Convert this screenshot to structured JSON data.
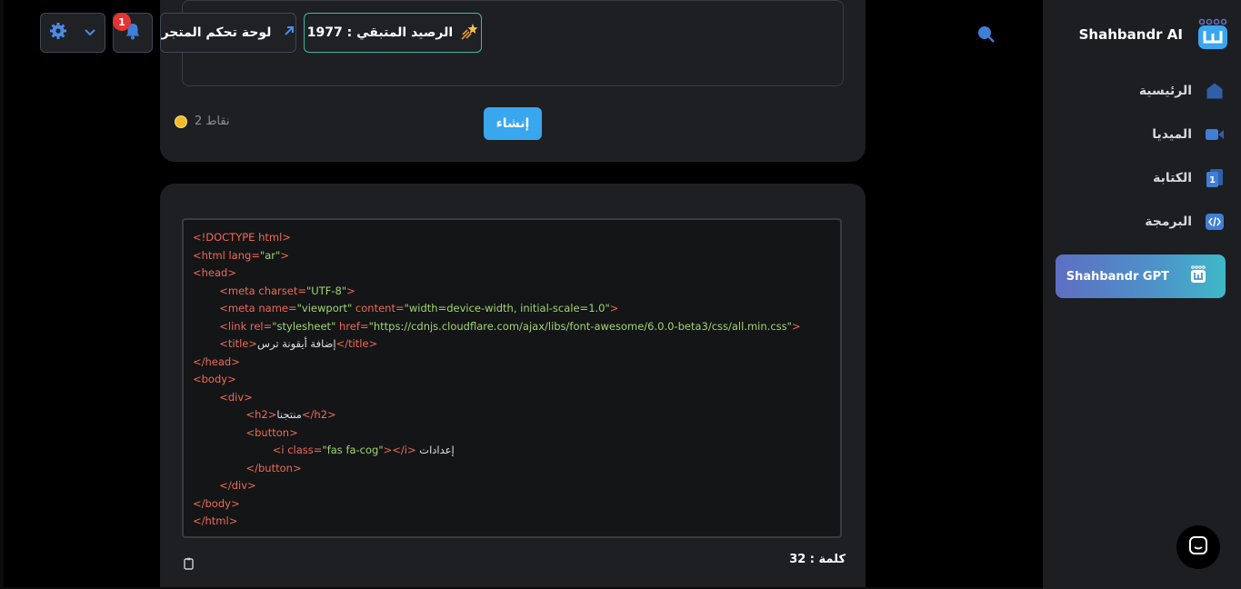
{
  "brand": {
    "name": "Shahbandr AI"
  },
  "sidebar": {
    "items": [
      {
        "label": "الرئيسية",
        "icon": "home-icon"
      },
      {
        "label": "الميديا",
        "icon": "video-icon"
      },
      {
        "label": "الكتابة",
        "icon": "document-icon"
      },
      {
        "label": "البرمجة",
        "icon": "code-icon"
      }
    ],
    "active": {
      "label": "Shahbandr GPT",
      "icon": "gpt-logo-icon"
    }
  },
  "topbar": {
    "balance_label": "الرصيد المتبقي : 1977",
    "dashboard_label": "لوحة تحكم المتجر",
    "notifications_count": "1"
  },
  "generator": {
    "create_label": "إنشاء",
    "points_label": "2 نقاط"
  },
  "result": {
    "code_lines": [
      "<!DOCTYPE html>",
      "<html lang=\"ar\">",
      "<head>",
      "        <meta charset=\"UTF-8\">",
      "        <meta name=\"viewport\" content=\"width=device-width, initial-scale=1.0\">",
      "        <link rel=\"stylesheet\" href=\"https://cdnjs.cloudflare.com/ajax/libs/font-awesome/6.0.0-beta3/css/all.min.css\">",
      "        <title>إضافة أيقونة ترس</title>",
      "</head>",
      "<body>",
      "        <div>",
      "                <h2>منتجنا</h2>",
      "                <button>",
      "                        <i class=\"fas fa-cog\"></i> إعدادات",
      "                </button>",
      "        </div>",
      "</body>",
      "</html>"
    ],
    "word_count_label": "كلمة : 32"
  },
  "colors": {
    "accent": "#38a7ee",
    "tag": "#ef6a55",
    "value": "#9fd66f",
    "badge": "#e53434"
  }
}
